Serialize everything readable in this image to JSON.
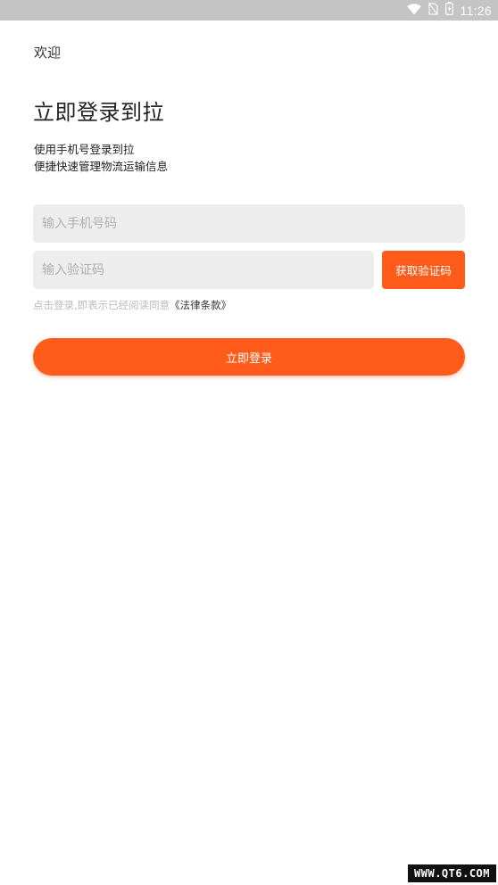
{
  "status_bar": {
    "time": "11:26",
    "icons": [
      "wifi-icon",
      "no-sim-icon",
      "battery-icon"
    ]
  },
  "header": {
    "welcome": "欢迎",
    "title": "立即登录到拉",
    "subtitle_line1": "使用手机号登录到拉",
    "subtitle_line2": "便捷快速管理物流运输信息"
  },
  "form": {
    "phone_placeholder": "输入手机号码",
    "code_placeholder": "输入验证码",
    "get_code_label": "获取验证码",
    "agreement_prefix": "点击登录,即表示已经阅读同意",
    "agreement_link": "《法律条款》",
    "login_label": "立即登录"
  },
  "watermark": "WWW.QT6.COM",
  "colors": {
    "accent": "#ff5b1a",
    "status_bar": "#c4c4c4",
    "input_bg": "#ededed"
  }
}
